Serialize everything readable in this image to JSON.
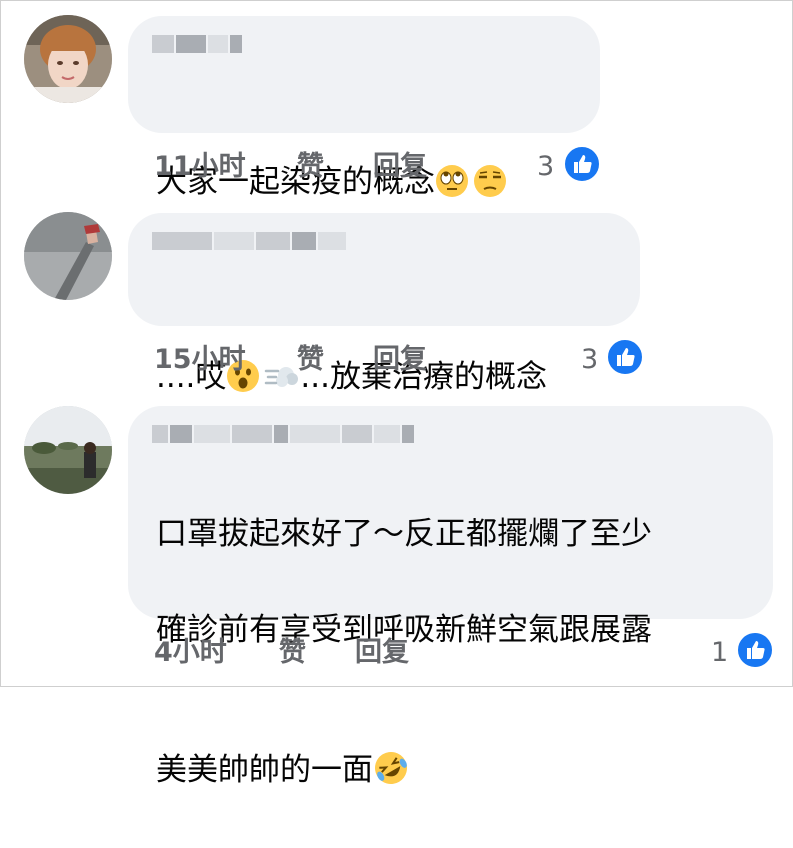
{
  "comments": [
    {
      "text": "大家一起染疫的概念",
      "emojis": [
        "face-with-rolling-eyes",
        "unamused-face"
      ],
      "time": "11小时",
      "like_label": "赞",
      "reply_label": "回复",
      "likes": "3"
    },
    {
      "text_before": "....哎",
      "text_after": "...放棄治療的概念",
      "emojis": [
        "face-with-open-mouth",
        "dashing-away"
      ],
      "time": "15小时",
      "like_label": "赞",
      "reply_label": "回复",
      "likes": "3"
    },
    {
      "lines": [
        "口罩拔起來好了～反正都擺爛了至少",
        "確診前有享受到呼吸新鮮空氣跟展露",
        "美美帥帥的一面"
      ],
      "emojis": [
        "rolling-on-the-floor-laughing"
      ],
      "time": "4小时",
      "like_label": "赞",
      "reply_label": "回复",
      "likes": "1"
    }
  ],
  "colors": {
    "bubble": "#f0f2f5",
    "meta_text": "#65676b",
    "like_blue": "#1877f2"
  }
}
